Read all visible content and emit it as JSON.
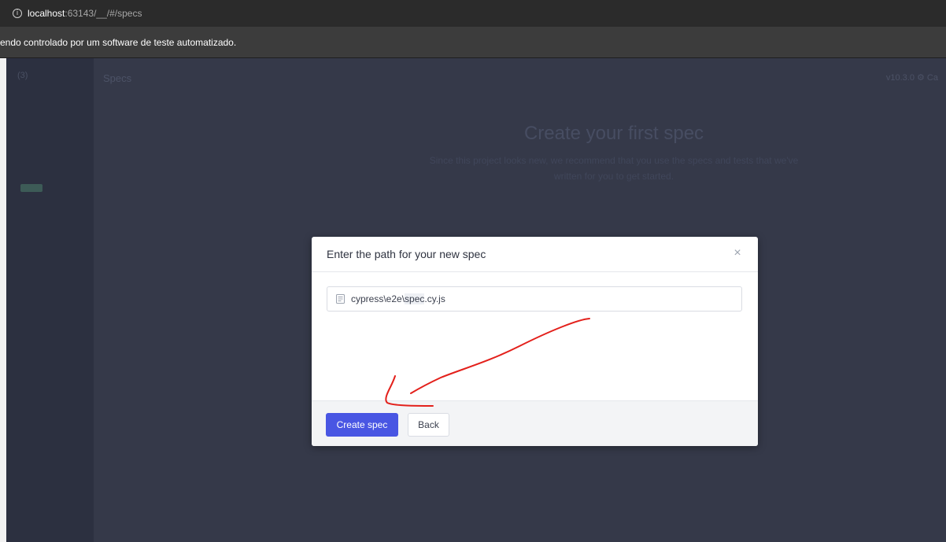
{
  "browser": {
    "url_host": "localhost",
    "url_rest": ":63143/__/#/specs",
    "infobar_text": "endo controlado por um software de teste automatizado."
  },
  "background": {
    "sidebar_logo": "(3)",
    "topbar_title": "Specs",
    "topbar_right": "v10.3.0  ⚙ Ca",
    "hero_title": "Create your first spec",
    "hero_subtitle": "Since this project looks new, we recommend that you use the specs and tests that we've written for you to get started."
  },
  "modal": {
    "title": "Enter the path for your new spec",
    "close_glyph": "×",
    "path_prefix": "cypress\\e2e\\",
    "path_selected": "spec",
    "path_suffix": ".cy.js",
    "create_label": "Create spec",
    "back_label": "Back"
  },
  "colors": {
    "primary": "#4956e3",
    "overlay_bg": "#353949",
    "annotation": "#e3201b"
  },
  "icons": {
    "info": "info-icon",
    "close": "close-icon",
    "file": "document-icon"
  }
}
